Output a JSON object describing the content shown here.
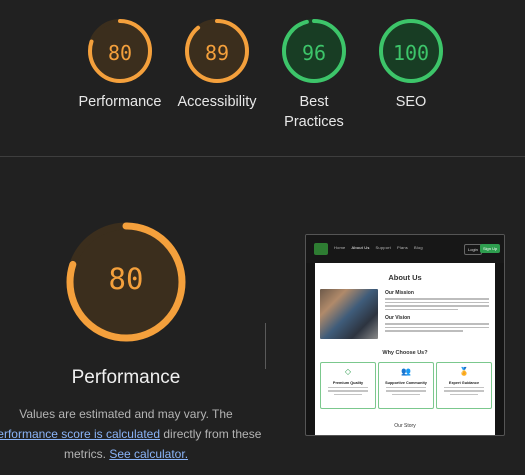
{
  "summary": {
    "gauges": [
      {
        "score": "80",
        "label": "Performance",
        "value": 0.8,
        "color": "#f4a03c",
        "track": "#3b2e1d"
      },
      {
        "score": "89",
        "label": "Accessibility",
        "value": 0.89,
        "color": "#f4a03c",
        "track": "#3b2e1d"
      },
      {
        "score": "96",
        "label": "Best Practices",
        "value": 0.96,
        "color": "#3dc56a",
        "track": "#183d24"
      },
      {
        "score": "100",
        "label": "SEO",
        "value": 1.0,
        "color": "#3dc56a",
        "track": "#183d24"
      }
    ]
  },
  "detail": {
    "score": "80",
    "value": 0.8,
    "color": "#f4a03c",
    "title": "Performance",
    "note_prefix": "Values are estimated and may vary. The",
    "note_link1": "performance score is calculated",
    "note_mid": "directly from these metrics.",
    "note_link2": "See calculator."
  },
  "screenshot": {
    "nav_links": [
      "Home",
      "About Us",
      "Support",
      "Plans",
      "Blog"
    ],
    "login": "Login",
    "signup": "Sign Up",
    "title": "About Us",
    "mission": "Our Mission",
    "vision": "Our Vision",
    "why": "Why Choose Us?",
    "cards": [
      {
        "icon": "diamond-icon",
        "glyph": "◇",
        "title": "Premium Quality"
      },
      {
        "icon": "people-icon",
        "glyph": "👥",
        "title": "Supportive Community"
      },
      {
        "icon": "award-icon",
        "glyph": "🏅",
        "title": "Expert Guidance"
      }
    ],
    "story": "Our Story"
  }
}
